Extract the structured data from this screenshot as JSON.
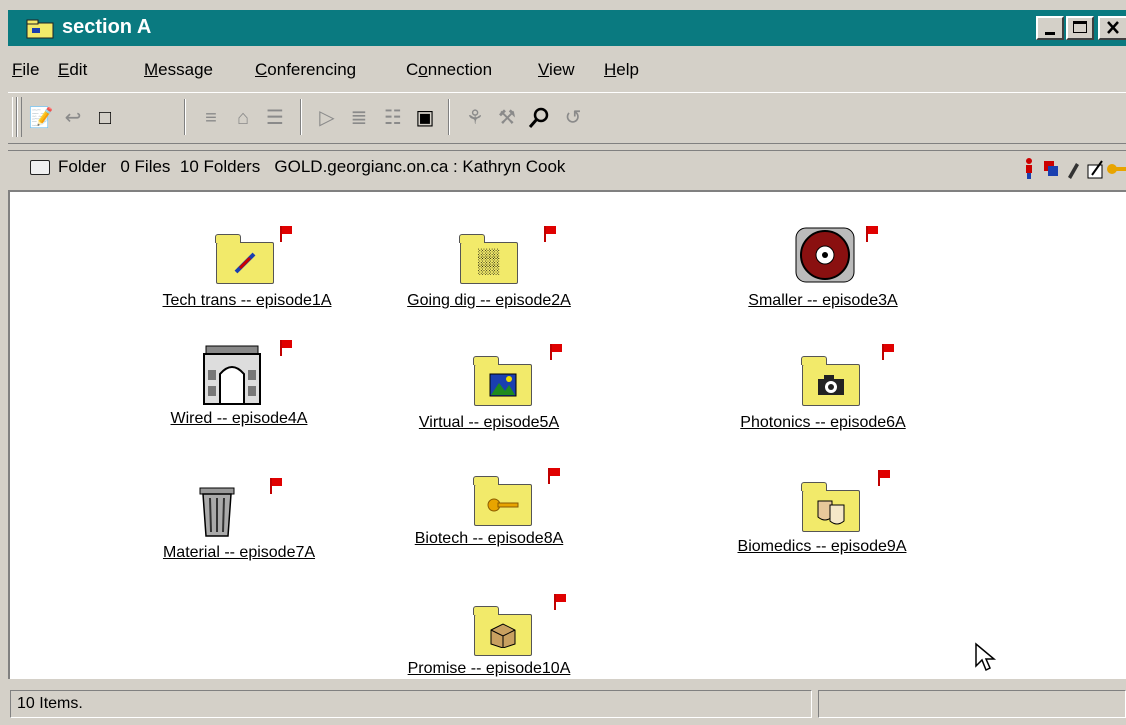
{
  "window": {
    "title": "section A",
    "controls": {
      "minimize": "minimize",
      "maximize": "maximize",
      "close": "close"
    }
  },
  "menu": [
    {
      "label": "File",
      "mnemonic": "F"
    },
    {
      "label": "Edit",
      "mnemonic": "E"
    },
    {
      "label": "Message",
      "mnemonic": "M"
    },
    {
      "label": "Conferencing",
      "mnemonic": "C"
    },
    {
      "label": "Connection",
      "mnemonic": "o"
    },
    {
      "label": "View",
      "mnemonic": "V"
    },
    {
      "label": "Help",
      "mnemonic": "H"
    }
  ],
  "toolbar": {
    "buttons": [
      {
        "icon": "new-message-icon"
      },
      {
        "icon": "reply-icon"
      },
      {
        "icon": "new-page-icon"
      },
      {
        "icon": "document-icon"
      },
      {
        "icon": "delete-icon"
      },
      {
        "icon": "properties-icon"
      },
      {
        "icon": "previous-icon"
      },
      {
        "icon": "next-icon"
      },
      {
        "icon": "attach-icon"
      },
      {
        "icon": "open-folder-icon"
      },
      {
        "icon": "chat-icon"
      },
      {
        "icon": "who-icon"
      },
      {
        "icon": "find-icon"
      },
      {
        "icon": "refresh-icon"
      }
    ]
  },
  "address": {
    "location": "Folder",
    "files": "0 Files",
    "folders": "10 Folders",
    "server": "GOLD.georgianc.on.ca : Kathryn Cook"
  },
  "items": [
    {
      "label": "Tech trans -- episode1A",
      "icon": "folder-tech-icon"
    },
    {
      "label": "Going dig -- episode2A",
      "icon": "folder-binary-icon"
    },
    {
      "label": "Smaller -- episode3A",
      "icon": "cd-icon"
    },
    {
      "label": "Wired -- episode4A",
      "icon": "arch-icon"
    },
    {
      "label": "Virtual -- episode5A",
      "icon": "folder-screen-icon"
    },
    {
      "label": "Photonics -- episode6A",
      "icon": "folder-camera-icon"
    },
    {
      "label": "Material -- episode7A",
      "icon": "trash-can-icon"
    },
    {
      "label": "Biotech -- episode8A",
      "icon": "folder-key-icon"
    },
    {
      "label": "Biomedics -- episode9A",
      "icon": "folder-masks-icon"
    },
    {
      "label": "Promise -- episode10A",
      "icon": "folder-box-icon"
    }
  ],
  "status": {
    "count": "10 Items.",
    "middle": "",
    "right": ""
  },
  "colors": {
    "titlebar": "#0a7a80",
    "folder": "#f2ea6a",
    "flag": "#e00000",
    "chrome": "#d4d0c8"
  }
}
